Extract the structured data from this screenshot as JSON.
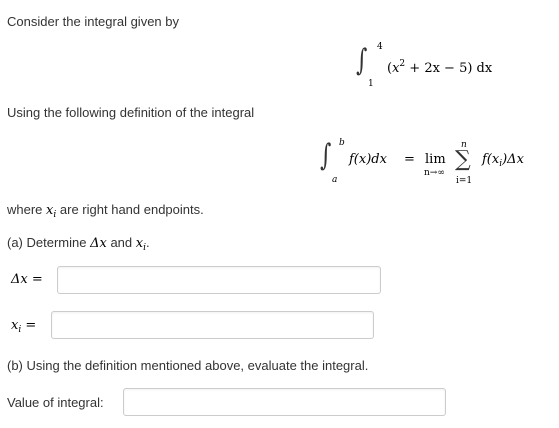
{
  "intro_text": "Consider the integral given by",
  "integral": {
    "upper": "4",
    "lower": "1",
    "integrand_x": "x",
    "integrand_exp": "2",
    "integrand_rest": " + 2x − 5) dx",
    "open_paren": "("
  },
  "definition_text": "Using the following definition of the integral",
  "definition": {
    "upper": "b",
    "lower": "a",
    "left_side": "f(x)dx",
    "equals": "=",
    "lim": "lim",
    "lim_sub": "n→∞",
    "sum_upper": "n",
    "sum_lower": "i=1",
    "right_side": "f(x",
    "right_sub": "i",
    "right_tail": ")Δx"
  },
  "where_text_pre": "where",
  "where_var": "x",
  "where_sub": "i",
  "where_text_post": "are right hand endpoints.",
  "part_a": {
    "text": "(a) Determine",
    "dx": "Δx",
    "and": "and",
    "xi": "x",
    "xi_sub": "i",
    "period": "."
  },
  "fields": {
    "delta_x_label": "Δx =",
    "delta_x_value": "",
    "xi_label_var": "x",
    "xi_label_sub": "i",
    "xi_label_eq": "=",
    "xi_value": ""
  },
  "part_b": {
    "text": "(b) Using the definition mentioned above, evaluate the integral."
  },
  "value_label": "Value of integral:",
  "value_input": ""
}
